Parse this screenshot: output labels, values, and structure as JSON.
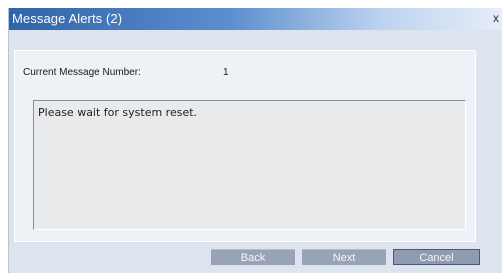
{
  "dialog": {
    "title": "Message Alerts (2)",
    "close_glyph": "x",
    "current_message_label": "Current Message Number:",
    "current_message_number": "1",
    "message_text": "Please wait for system reset."
  },
  "buttons": {
    "back": "Back",
    "next": "Next",
    "cancel": "Cancel"
  },
  "colors": {
    "titlebar_start": "#2e64a8",
    "dialog_background": "#dde4ed",
    "button_background": "#98a3b6"
  }
}
